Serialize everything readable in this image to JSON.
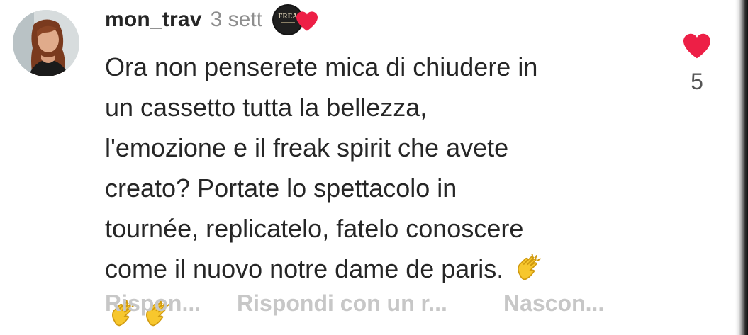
{
  "comment": {
    "username": "mon_trav",
    "time": "3 sett",
    "badge_text": "FREA",
    "lines": [
      "Ora non penserete mica di chiudere in",
      "un cassetto tutta la bellezza,",
      "l'emozione e il freak spirit che avete",
      "creato? Portate lo spettacolo in",
      "tournée, replicatelo, fatelo conoscere",
      "come il nuovo notre dame de paris."
    ],
    "emojis": [
      "clapping-hands",
      "clapping-hands",
      "clapping-hands"
    ],
    "like_count": "5"
  },
  "actions": {
    "reply": "Rispon...",
    "reply_with": "Rispondi con un r...",
    "hide": "Nascon..."
  },
  "colors": {
    "heart": "#ed1f46",
    "username": "#262626",
    "muted": "#8e8e8e",
    "action": "#c7c7c7"
  }
}
